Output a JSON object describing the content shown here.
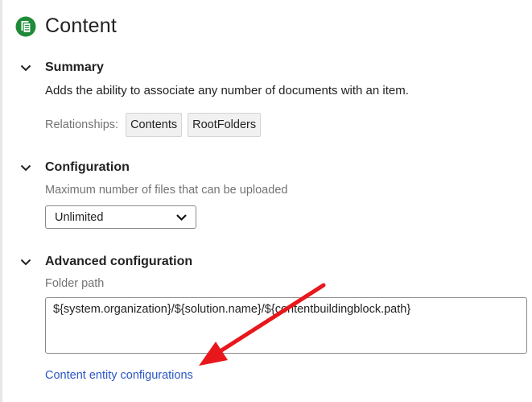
{
  "header": {
    "title": "Content",
    "icon": "content-document-icon",
    "icon_color": "#1f8a3a"
  },
  "summary": {
    "title": "Summary",
    "description": "Adds the ability to associate any number of documents with an item.",
    "relationships_label": "Relationships:",
    "relationships": [
      "Contents",
      "RootFolders"
    ]
  },
  "configuration": {
    "title": "Configuration",
    "max_files_label": "Maximum number of files that can be uploaded",
    "max_files_value": "Unlimited"
  },
  "advanced": {
    "title": "Advanced configuration",
    "folder_path_label": "Folder path",
    "folder_path_value": "${system.organization}/${solution.name}/${contentbuildingblock.path}",
    "link_label": "Content entity configurations"
  },
  "colors": {
    "link": "#2a55c4",
    "annotation_arrow": "#e8171c"
  }
}
